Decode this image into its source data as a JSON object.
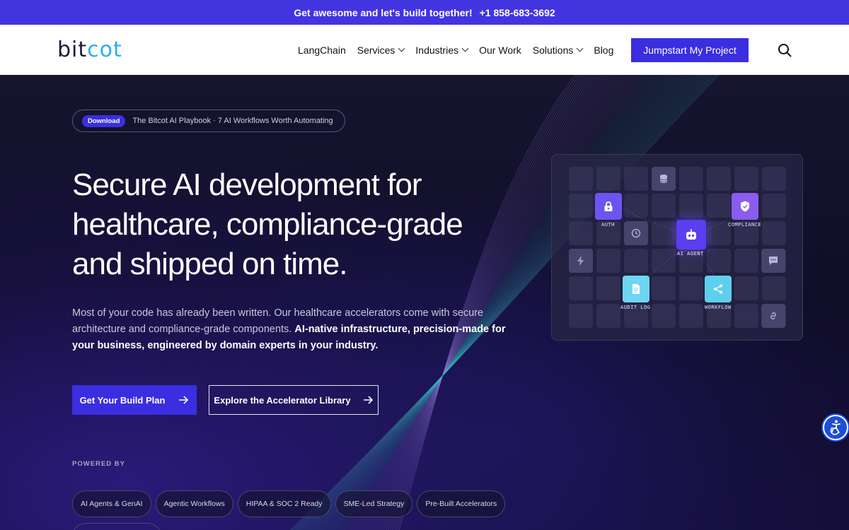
{
  "topbar": {
    "text": "Get awesome and let's build together!",
    "phone": "+1 858-683-3692"
  },
  "nav": {
    "logo_left": "bit",
    "logo_right": "cot",
    "items": [
      {
        "label": "LangChain",
        "dropdown": false
      },
      {
        "label": "Services",
        "dropdown": true
      },
      {
        "label": "Industries",
        "dropdown": true
      },
      {
        "label": "Our Work",
        "dropdown": false
      },
      {
        "label": "Solutions",
        "dropdown": true
      },
      {
        "label": "Blog",
        "dropdown": false
      }
    ],
    "cta": "Jumpstart My Project",
    "search_icon": "search-icon"
  },
  "hero": {
    "badge": "Download",
    "pill_text": "The Bitcot AI Playbook · 7 AI Workflows Worth Automating",
    "headline_lines": [
      "Secure AI development for",
      "healthcare, compliance-grade",
      "and shipped on time."
    ],
    "desc_plain": "Most of your code has already been written. Our healthcare accelerators come with secure architecture and compliance-grade components.",
    "desc_bold": "AI-native infrastructure, precision-made for your business, engineered by domain experts in your industry.",
    "primary_cta": "Get Your Build Plan",
    "secondary_cta": "Explore the Accelerator Library",
    "powered_by": "POWERED BY",
    "tags": [
      "AI Agents & GenAI",
      "Agentic Workflows",
      "HIPAA & SOC 2 Ready",
      "SME-Led Strategy",
      "Pre-Built Accelerators"
    ]
  },
  "diagram": {
    "nodes": {
      "auth": "AUTH",
      "compliance": "COMPLIANCE",
      "agent": "AI AGENT",
      "audit": "AUDIT LOG",
      "workflow": "WORKFLOW"
    }
  },
  "colors": {
    "brand": "#3a2ee0",
    "accent": "#2ab0e8",
    "topbar": "#4235e0"
  }
}
